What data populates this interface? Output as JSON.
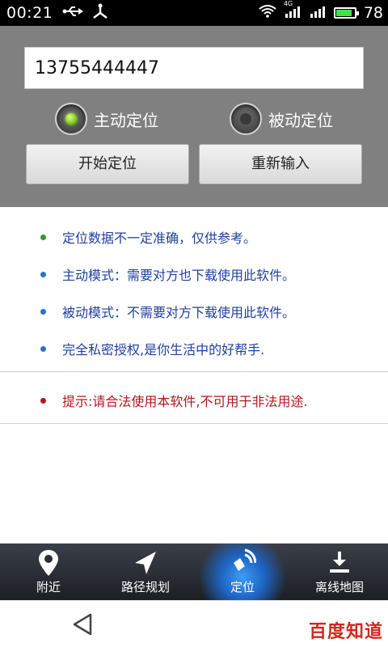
{
  "status_bar": {
    "time": "00:21",
    "network_label": "4G",
    "battery_percent": "78",
    "battery_level": 0.78,
    "left_icons": [
      "usb-icon",
      "usb-debug-icon"
    ],
    "right_icons": [
      "wifi-icon",
      "signal-4g-icon",
      "signal-icon",
      "battery-icon"
    ]
  },
  "form": {
    "phone_value": "13755444447",
    "radio_active": "主动定位",
    "radio_passive": "被动定位",
    "selected": "主动定位",
    "start_button": "开始定位",
    "reset_button": "重新输入"
  },
  "info": {
    "items": [
      {
        "text": "定位数据不一定准确，仅供参考。",
        "bullet_color": "#2e9a2e"
      },
      {
        "text": "主动模式：需要对方也下载使用此软件。",
        "bullet_color": "#2a72c8"
      },
      {
        "text": "被动模式：不需要对方下载使用此软件。",
        "bullet_color": "#2a72c8"
      },
      {
        "text": "完全私密授权,是你生活中的好帮手.",
        "bullet_color": "#2a72c8"
      }
    ],
    "warning": {
      "text": "提示:请合法使用本软件,不可用于非法用途.",
      "bullet_color": "#b3161b"
    }
  },
  "bottom_nav": {
    "items": [
      {
        "label": "附近",
        "icon": "location-pin-icon"
      },
      {
        "label": "路径规划",
        "icon": "navigation-arrow-icon"
      },
      {
        "label": "定位",
        "icon": "locate-signal-icon",
        "active": true
      },
      {
        "label": "离线地图",
        "icon": "download-icon"
      }
    ]
  },
  "system": {
    "back_icon": "back-triangle-icon",
    "watermark": "百度知道"
  },
  "colors": {
    "panel_bg": "#808080",
    "info_text": "#1f3fa0",
    "warning_text": "#b3161b",
    "nav_active": "#1e64c4"
  }
}
